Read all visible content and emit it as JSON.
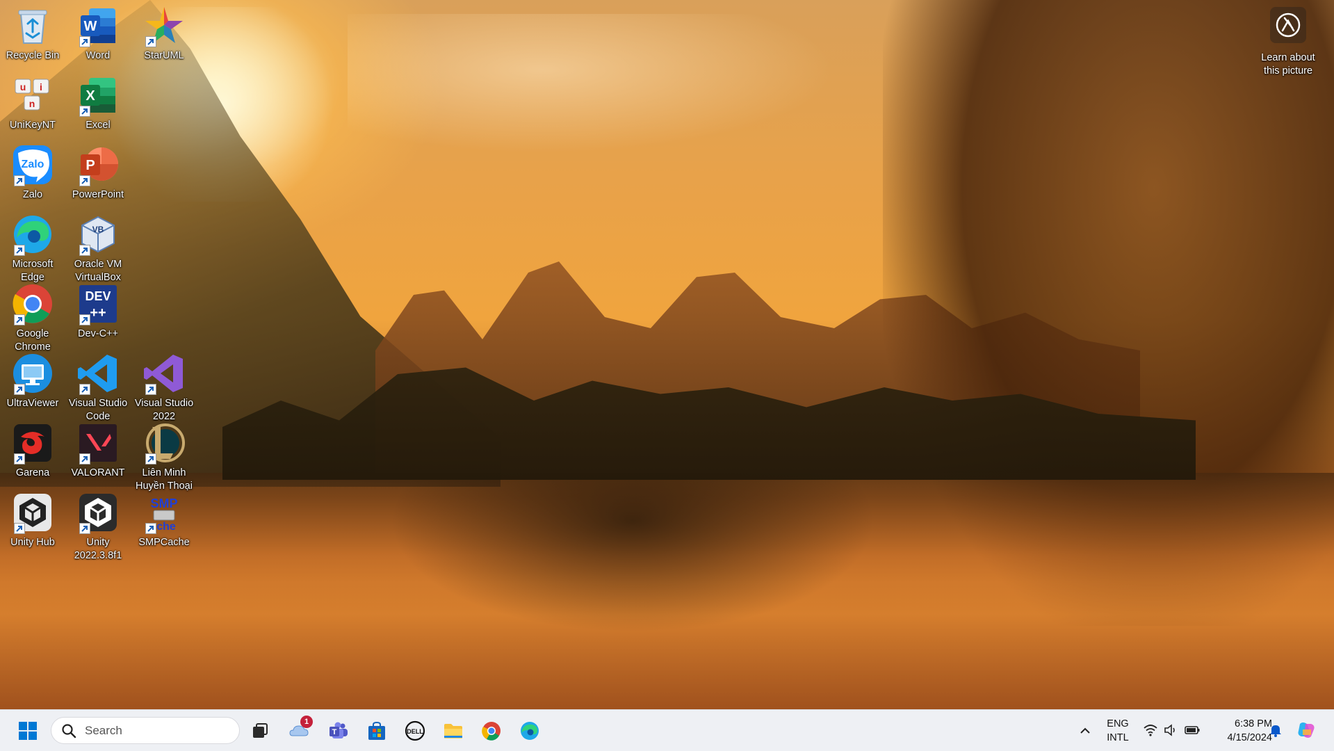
{
  "desktop": {
    "icons": [
      {
        "label": "Recycle Bin",
        "icon": "recycle-bin-icon",
        "shortcut": false
      },
      {
        "label": "Word",
        "icon": "word-icon",
        "shortcut": true
      },
      {
        "label": "StarUML",
        "icon": "staruml-icon",
        "shortcut": true
      },
      {
        "label": "UniKeyNT",
        "icon": "unikey-icon",
        "shortcut": false
      },
      {
        "label": "Excel",
        "icon": "excel-icon",
        "shortcut": true
      },
      {
        "label": "Zalo",
        "icon": "zalo-icon",
        "shortcut": true
      },
      {
        "label": "PowerPoint",
        "icon": "powerpoint-icon",
        "shortcut": true
      },
      {
        "label": "Microsoft\nEdge",
        "icon": "edge-icon",
        "shortcut": true
      },
      {
        "label": "Oracle VM\nVirtualBox",
        "icon": "virtualbox-icon",
        "shortcut": true
      },
      {
        "label": "Google\nChrome",
        "icon": "chrome-icon",
        "shortcut": true
      },
      {
        "label": "Dev-C++",
        "icon": "devcpp-icon",
        "shortcut": true
      },
      {
        "label": "UltraViewer",
        "icon": "ultraviewer-icon",
        "shortcut": true
      },
      {
        "label": "Visual Studio\nCode",
        "icon": "vscode-icon",
        "shortcut": true
      },
      {
        "label": "Visual Studio\n2022",
        "icon": "visual-studio-icon",
        "shortcut": true
      },
      {
        "label": "Garena",
        "icon": "garena-icon",
        "shortcut": true
      },
      {
        "label": "VALORANT",
        "icon": "valorant-icon",
        "shortcut": true
      },
      {
        "label": "Liên Minh\nHuyền Thoại",
        "icon": "league-icon",
        "shortcut": true
      },
      {
        "label": "Unity Hub",
        "icon": "unity-hub-icon",
        "shortcut": true
      },
      {
        "label": "Unity\n2022.3.8f1",
        "icon": "unity-icon",
        "shortcut": true
      },
      {
        "label": "SMPCache",
        "icon": "smpcache-icon",
        "shortcut": true
      }
    ],
    "learn_about": {
      "label": "Learn about\nthis picture",
      "icon": "camera-icon"
    }
  },
  "taskbar": {
    "start_icon": "windows-start-icon",
    "search": {
      "placeholder": "Search"
    },
    "pinned": [
      {
        "name": "task-view",
        "icon": "task-view-icon"
      },
      {
        "name": "onedrive",
        "icon": "onedrive-icon",
        "badge": "1"
      },
      {
        "name": "teams",
        "icon": "teams-icon"
      },
      {
        "name": "microsoft-store",
        "icon": "store-icon"
      },
      {
        "name": "dell",
        "icon": "dell-icon"
      },
      {
        "name": "file-explorer",
        "icon": "folder-icon"
      },
      {
        "name": "chrome",
        "icon": "chrome-icon"
      },
      {
        "name": "edge",
        "icon": "edge-icon"
      }
    ],
    "tray": {
      "lang_primary": "ENG",
      "lang_secondary": "INTL",
      "time": "6:38 PM",
      "date": "4/15/2024"
    }
  },
  "colors": {
    "taskbar_bg": "#eef0f4",
    "accent_blue": "#0078d4",
    "notification_red": "#c4203a"
  }
}
